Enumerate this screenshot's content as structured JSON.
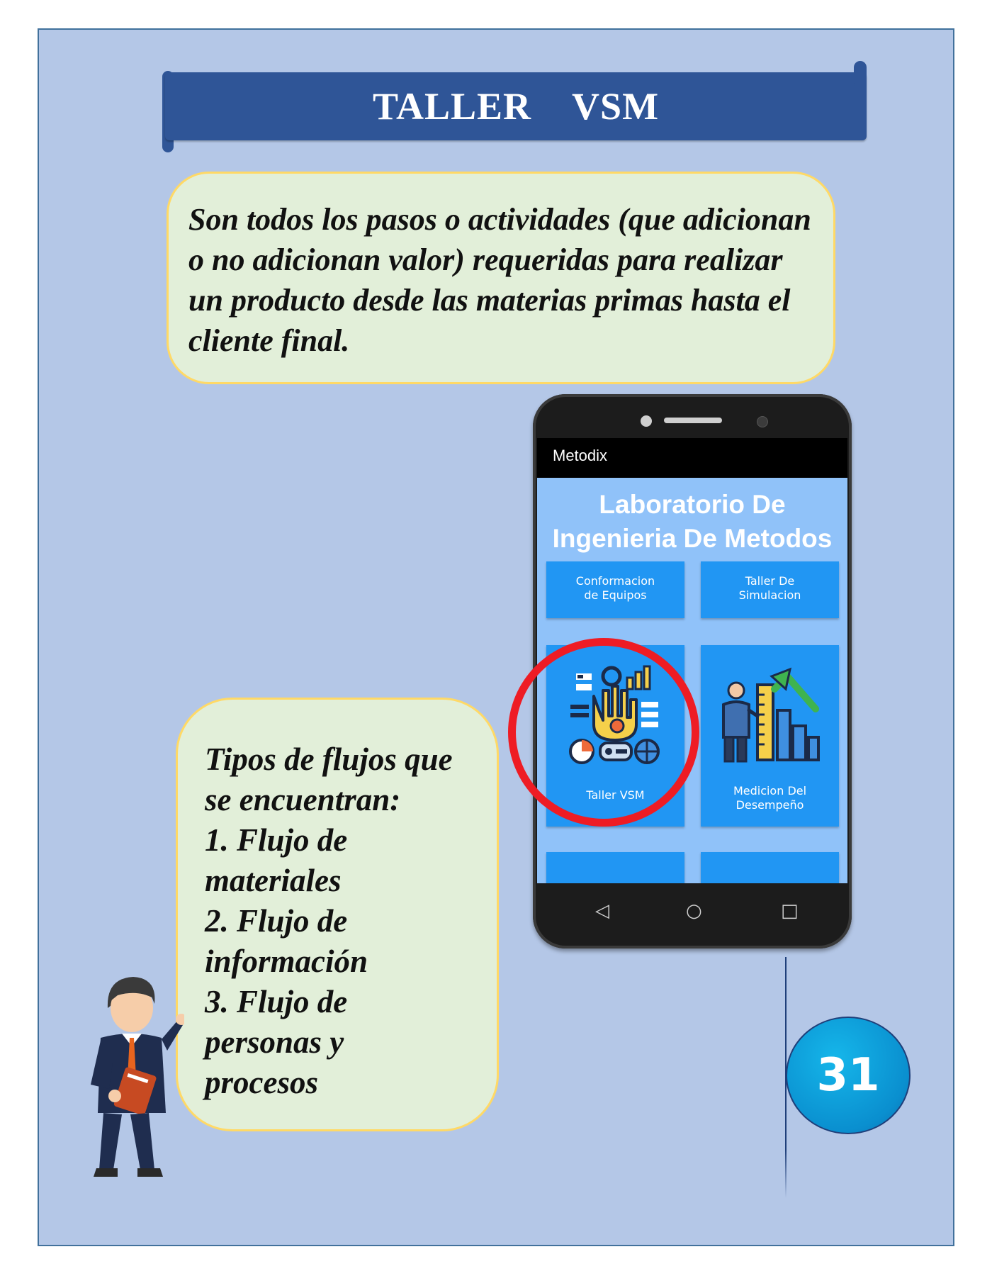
{
  "banner": {
    "title": "TALLER    VSM"
  },
  "definition": {
    "text": "Son todos los pasos o actividades (que adicionan o no adicionan valor) requeridas para realizar un producto desde las materias primas hasta el cliente final."
  },
  "flow_types": {
    "lines": [
      "Tipos de flujos que",
      "se encuentran:",
      "1. Flujo de",
      "materiales",
      "2. Flujo de",
      "información",
      "3. Flujo de",
      "personas y",
      "procesos"
    ]
  },
  "phone_app": {
    "app_name": "Metodix",
    "heading_line1": "Laboratorio De",
    "heading_line2": "Ingenieria De Metodos",
    "tiles": [
      {
        "line1": "Conformacion",
        "line2": "de Equipos",
        "icon": "none"
      },
      {
        "line1": "Taller De",
        "line2": "Simulacion",
        "icon": "none"
      },
      {
        "line1": "Taller VSM",
        "line2": "",
        "icon": "robotic-hand-icon"
      },
      {
        "line1": "Medicion Del",
        "line2": "Desempeño",
        "icon": "performance-chart-icon"
      }
    ],
    "nav": {
      "back": "◁",
      "home": "○",
      "recents": "□"
    },
    "highlight_color": "#ee1c24"
  },
  "page_number": "31",
  "colors": {
    "page_background": "#b4c7e7",
    "banner": "#2f5597",
    "bubble_fill": "#e2efd9",
    "bubble_border": "#ffd966",
    "tile": "#2196f3",
    "app_screen": "#90c2f9"
  }
}
